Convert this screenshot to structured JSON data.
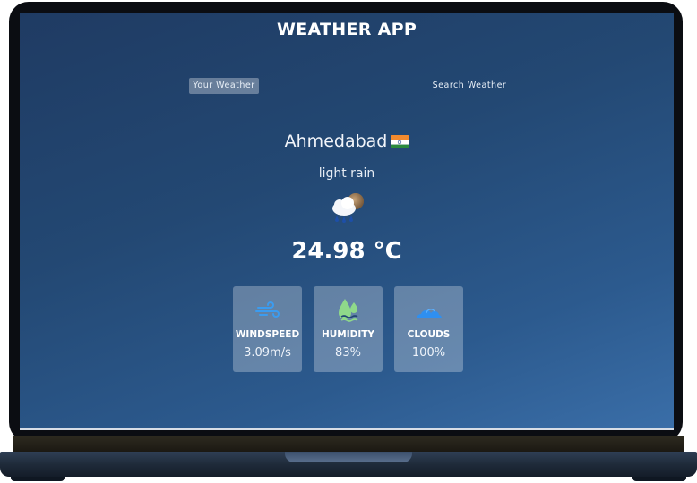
{
  "app": {
    "title": "WEATHER APP"
  },
  "tabs": {
    "your_weather": "Your Weather",
    "search_weather": "Search Weather"
  },
  "current": {
    "city": "Ahmedabad",
    "country_flag": "india-flag",
    "description": "light rain",
    "condition_icon": "rain-cloud-icon",
    "temperature": "24.98 °C"
  },
  "stats": [
    {
      "icon": "wind-icon",
      "label": "WINDSPEED",
      "value": "3.09m/s"
    },
    {
      "icon": "humidity-icon",
      "label": "HUMIDITY",
      "value": "83%"
    },
    {
      "icon": "clouds-icon",
      "label": "CLOUDS",
      "value": "100%"
    }
  ],
  "colors": {
    "background_top": "#1f3b63",
    "background_bottom": "#3a6ea8",
    "wind_icon": "#3b9cf0",
    "humidity_icon": "#8fd98a",
    "clouds_icon": "#2f8ff0"
  }
}
